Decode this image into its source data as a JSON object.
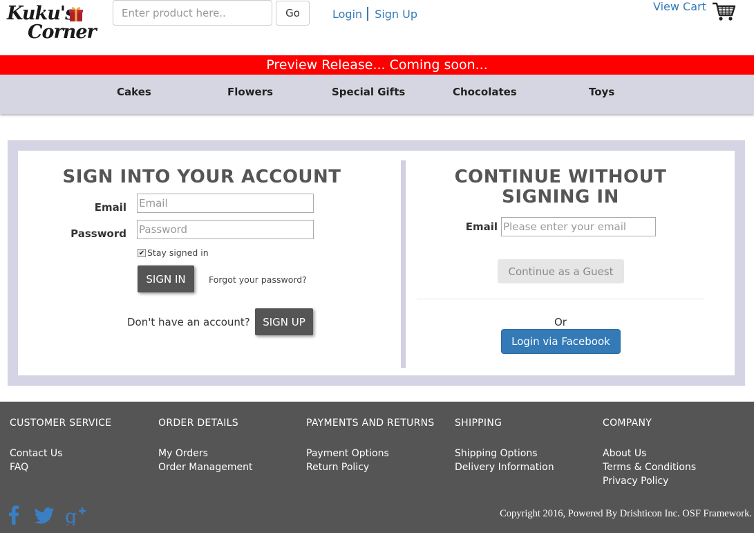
{
  "header": {
    "logo_line1": "Kuku's",
    "logo_line2": "Corner",
    "search_placeholder": "Enter product here..",
    "go_label": "Go",
    "login_label": "Login",
    "signup_label": "Sign Up",
    "view_cart_label": "View Cart"
  },
  "banner": {
    "text": "Preview Release... Coming soon..."
  },
  "nav": {
    "items": [
      "Cakes",
      "Flowers",
      "Special Gifts",
      "Chocolates",
      "Toys"
    ]
  },
  "signin": {
    "title": "SIGN INTO YOUR ACCOUNT",
    "email_label": "Email",
    "email_placeholder": "Email",
    "password_label": "Password",
    "password_placeholder": "Password",
    "stay_signed_in": "Stay signed in",
    "stay_signed_in_checked": true,
    "signin_button": "SIGN IN",
    "forgot_link": "Forgot your password?",
    "no_account_text": "Don't have an account?",
    "signup_button": "SIGN UP"
  },
  "guest": {
    "title_line1": "CONTINUE WITHOUT",
    "title_line2": "SIGNING IN",
    "email_label": "Email",
    "email_placeholder": "Please enter your email",
    "guest_button": "Continue as a Guest",
    "or_text": "Or",
    "facebook_button": "Login via Facebook"
  },
  "footer": {
    "columns": [
      {
        "heading": "CUSTOMER SERVICE",
        "links": [
          "Contact Us",
          "FAQ"
        ]
      },
      {
        "heading": "ORDER DETAILS",
        "links": [
          "My Orders",
          "Order Management"
        ]
      },
      {
        "heading": "PAYMENTS AND RETURNS",
        "links": [
          "Payment Options",
          "Return Policy"
        ]
      },
      {
        "heading": "SHIPPING",
        "links": [
          "Shipping Options",
          "Delivery Information"
        ]
      },
      {
        "heading": "COMPANY",
        "links": [
          "About Us",
          "Terms & Conditions",
          "Privacy Policy"
        ]
      }
    ],
    "social_icons": [
      "facebook-icon",
      "twitter-icon",
      "google-plus-icon"
    ],
    "copyright": "Copyright 2016, Powered By Drishticon Inc. OSF Framework."
  },
  "colors": {
    "banner": "#ff0000",
    "nav_bg": "#d6d6e2",
    "link": "#337ab7",
    "dark_button": "#555555",
    "facebook_button": "#337ab7",
    "footer_bg": "#555555",
    "social_icon": "#337ab7"
  }
}
